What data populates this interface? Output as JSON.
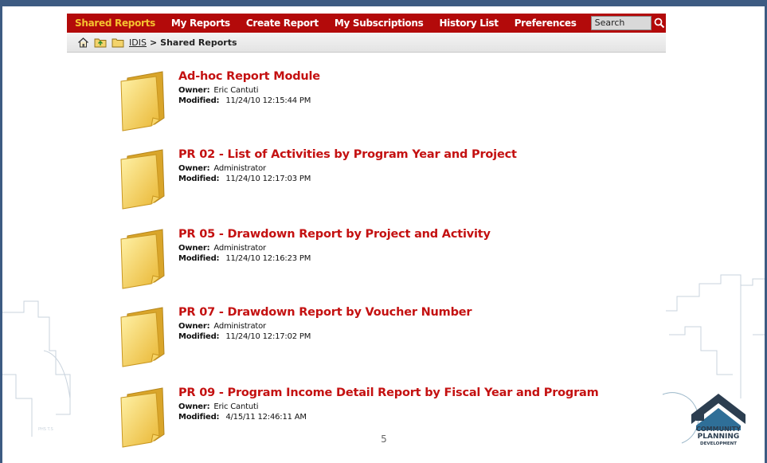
{
  "nav": {
    "items": [
      {
        "label": "Shared Reports",
        "active": true
      },
      {
        "label": "My Reports",
        "active": false
      },
      {
        "label": "Create Report",
        "active": false
      },
      {
        "label": "My Subscriptions",
        "active": false
      },
      {
        "label": "History List",
        "active": false
      },
      {
        "label": "Preferences",
        "active": false
      }
    ],
    "search_value": "Search"
  },
  "breadcrumb": {
    "root_link": "IDIS",
    "separator": ">",
    "current": "Shared Reports"
  },
  "reports": [
    {
      "title": "Ad-hoc Report Module",
      "owner_label": "Owner:",
      "owner": "Eric Cantuti",
      "modified_label": "Modified:",
      "modified": "11/24/10 12:15:44 PM"
    },
    {
      "title": "PR 02 - List of Activities by Program Year and Project",
      "owner_label": "Owner:",
      "owner": "Administrator",
      "modified_label": "Modified:",
      "modified": "11/24/10 12:17:03 PM"
    },
    {
      "title": "PR 05 - Drawdown Report by Project and Activity",
      "owner_label": "Owner:",
      "owner": "Administrator",
      "modified_label": "Modified:",
      "modified": "11/24/10 12:16:23 PM"
    },
    {
      "title": "PR 07 - Drawdown Report by Voucher Number",
      "owner_label": "Owner:",
      "owner": "Administrator",
      "modified_label": "Modified:",
      "modified": "11/24/10 12:17:02 PM"
    },
    {
      "title": "PR 09 - Program Income Detail Report by Fiscal Year and Program",
      "owner_label": "Owner:",
      "owner": "Eric Cantuti",
      "modified_label": "Modified:",
      "modified": "4/15/11 12:46:11 AM"
    }
  ],
  "page_number": "5",
  "logo": {
    "line1": "COMMUNITY",
    "line2": "PLANNING",
    "line3": "DEVELOPMENT"
  },
  "colors": {
    "nav_bg": "#b30a0a",
    "nav_active": "#f5c230",
    "title_red": "#c41111",
    "frame_blue": "#3d5b82"
  },
  "icons": {
    "home": "home-icon",
    "folder_up": "folder-up-icon",
    "folder": "folder-icon",
    "search": "search-icon",
    "report_folder": "report-folder-icon"
  }
}
